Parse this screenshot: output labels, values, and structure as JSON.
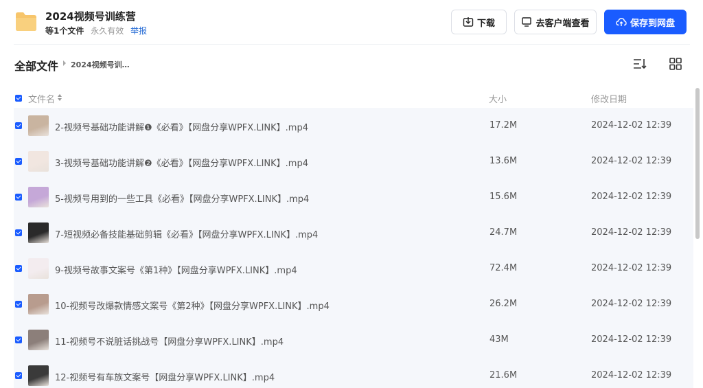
{
  "share": {
    "title": "2024视频号训练营",
    "file_count": "等1个文件",
    "validity": "永久有效",
    "report": "举报"
  },
  "toolbar": {
    "download_label": "下载",
    "client_label": "去客户端查看",
    "save_label": "保存到网盘"
  },
  "breadcrumb": {
    "root": "全部文件",
    "current": "2024视频号训…"
  },
  "columns": {
    "name": "文件名",
    "size": "大小",
    "date": "修改日期"
  },
  "files": [
    {
      "name": "2-视频号基础功能讲解❶《必看》【网盘分享WPFX.LINK】.mp4",
      "size": "17.2M",
      "date": "2024-12-02 12:39",
      "thumb_color": "#c9b4a0"
    },
    {
      "name": "3-视频号基础功能讲解❷《必看》【网盘分享WPFX.LINK】.mp4",
      "size": "13.6M",
      "date": "2024-12-02 12:39",
      "thumb_color": "#f1e6e0"
    },
    {
      "name": "5-视频号用到的一些工具《必看》【网盘分享WPFX.LINK】.mp4",
      "size": "15.6M",
      "date": "2024-12-02 12:39",
      "thumb_color": "#c5a8d8"
    },
    {
      "name": "7-短视频必备技能基础剪辑《必看》【网盘分享WPFX.LINK】.mp4",
      "size": "24.7M",
      "date": "2024-12-02 12:39",
      "thumb_color": "#2a2a2a"
    },
    {
      "name": "9-视频号故事文案号《第1种》【网盘分享WPFX.LINK】.mp4",
      "size": "72.4M",
      "date": "2024-12-02 12:39",
      "thumb_color": "#f3ecef"
    },
    {
      "name": "10-视频号改爆款情感文案号《第2种》【网盘分享WPFX.LINK】.mp4",
      "size": "26.2M",
      "date": "2024-12-02 12:39",
      "thumb_color": "#b89c8e"
    },
    {
      "name": "11-视频号不说脏话挑战号【网盘分享WPFX.LINK】.mp4",
      "size": "43M",
      "date": "2024-12-02 12:39",
      "thumb_color": "#8c7f7a"
    },
    {
      "name": "12-视频号有车族文案号【网盘分享WPFX.LINK】.mp4",
      "size": "21.6M",
      "date": "2024-12-02 12:39",
      "thumb_color": "#3a3a3a"
    }
  ],
  "colors": {
    "accent": "#1a5cff",
    "link": "#2b6fd6",
    "folder": "#f7c56b"
  }
}
